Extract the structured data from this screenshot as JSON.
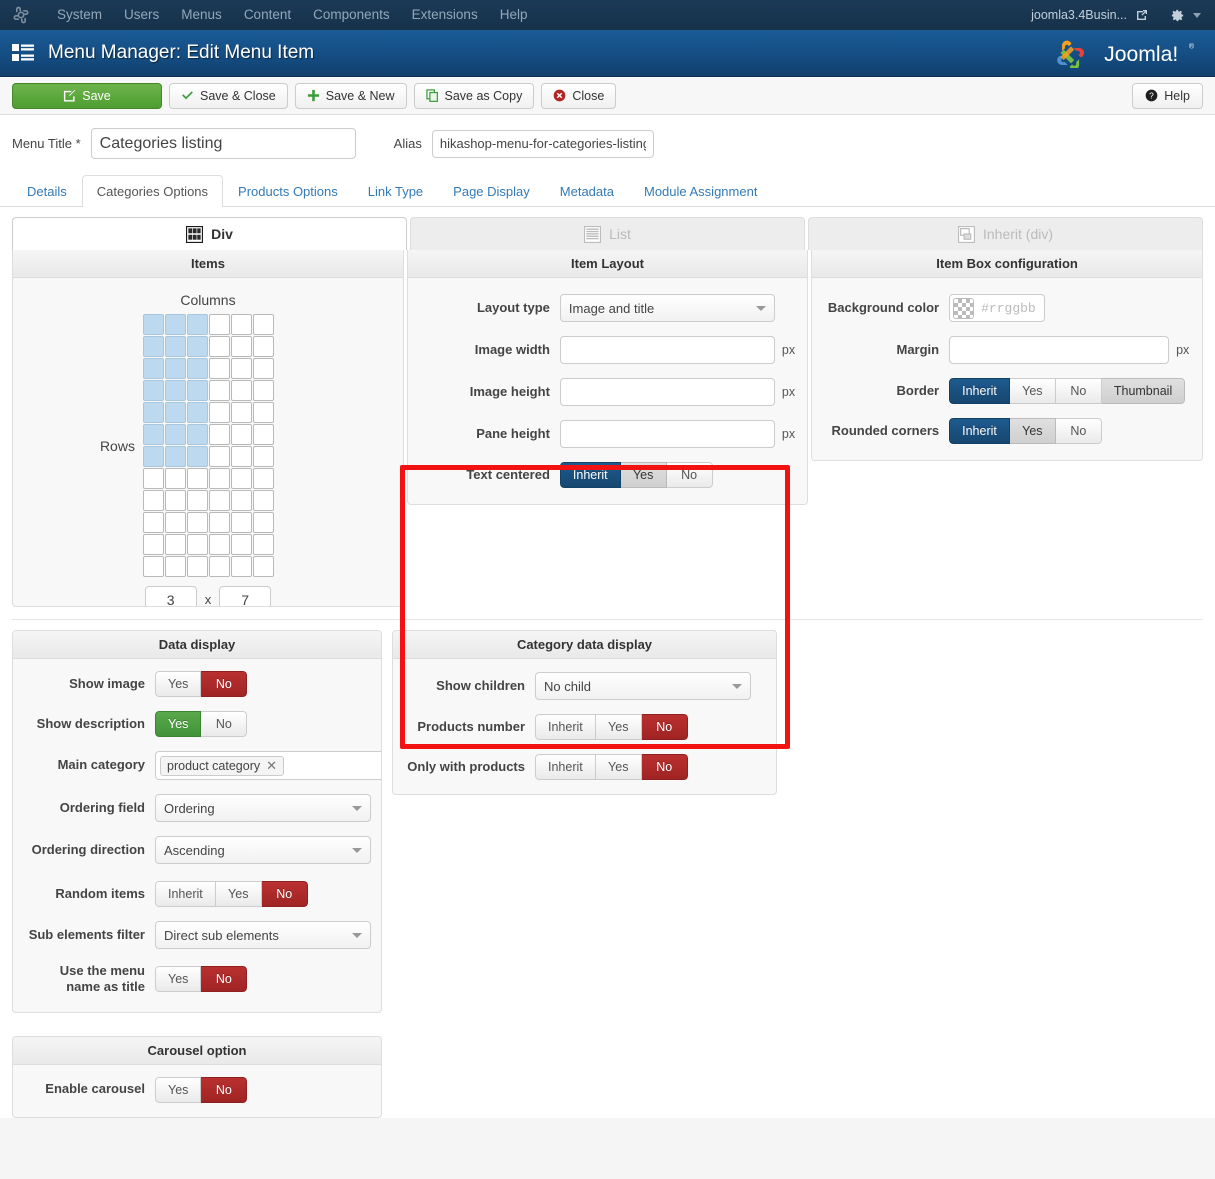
{
  "adminbar": {
    "logo_icon": "joomla-brand-icon",
    "items": [
      {
        "label": "System",
        "name": "adminbar-item-system"
      },
      {
        "label": "Users",
        "name": "adminbar-item-users"
      },
      {
        "label": "Menus",
        "name": "adminbar-item-menus"
      },
      {
        "label": "Content",
        "name": "adminbar-item-content"
      },
      {
        "label": "Components",
        "name": "adminbar-item-components"
      },
      {
        "label": "Extensions",
        "name": "adminbar-item-extensions"
      },
      {
        "label": "Help",
        "name": "adminbar-item-help"
      }
    ],
    "site_name": "joomla3.4Busin...",
    "external_link_icon": "external-link-icon",
    "gear_icon": "gear-icon",
    "caret_icon": "chevron-down-icon"
  },
  "header": {
    "menu_icon": "menu-list-icon",
    "title": "Menu Manager: Edit Menu Item",
    "brand": "Joomla!"
  },
  "toolbar": {
    "save_label": "Save",
    "save_close_label": "Save & Close",
    "save_new_label": "Save & New",
    "save_copy_label": "Save as Copy",
    "close_label": "Close",
    "help_label": "Help"
  },
  "titlerow": {
    "menu_title_label": "Menu Title *",
    "menu_title_value": "Categories listing",
    "alias_label": "Alias",
    "alias_value": "hikashop-menu-for-categories-listing"
  },
  "tabs": [
    {
      "label": "Details",
      "active": false
    },
    {
      "label": "Categories Options",
      "active": true
    },
    {
      "label": "Products Options",
      "active": false
    },
    {
      "label": "Link Type",
      "active": false
    },
    {
      "label": "Page Display",
      "active": false
    },
    {
      "label": "Metadata",
      "active": false
    },
    {
      "label": "Module Assignment",
      "active": false
    }
  ],
  "layout_tabs": [
    {
      "label": "Div",
      "icon": "grid-blocks-icon",
      "active": true
    },
    {
      "label": "List",
      "icon": "list-lines-icon",
      "active": false
    },
    {
      "label": "Inherit (div)",
      "icon": "inherit-boxes-icon",
      "active": false
    }
  ],
  "items_panel": {
    "title": "Items",
    "columns_label": "Columns",
    "rows_label": "Rows",
    "grid_cols": 6,
    "grid_rows": 12,
    "selected_cols": 3,
    "selected_rows": 7,
    "cols_value": "3",
    "rows_value": "7",
    "x_label": "x"
  },
  "item_layout": {
    "title": "Item Layout",
    "highlighted": true,
    "highlight_color": "#f21212",
    "layout_type": {
      "label": "Layout type",
      "value": "Image and title"
    },
    "image_width": {
      "label": "Image width",
      "value": "",
      "unit": "px"
    },
    "image_height": {
      "label": "Image height",
      "value": "",
      "unit": "px"
    },
    "pane_height": {
      "label": "Pane height",
      "value": "",
      "unit": "px"
    },
    "text_centered": {
      "label": "Text centered",
      "options": [
        "Inherit",
        "Yes",
        "No"
      ],
      "selected": "Inherit",
      "selected_style": "blue"
    }
  },
  "item_box": {
    "title": "Item Box configuration",
    "background_color": {
      "label": "Background color",
      "value": "",
      "placeholder": "#rrggbb",
      "swatch": "transparent-checker"
    },
    "margin": {
      "label": "Margin",
      "value": "",
      "unit": "px"
    },
    "border": {
      "label": "Border",
      "options": [
        "Inherit",
        "Yes",
        "No",
        "Thumbnail"
      ],
      "selected": "Inherit",
      "selected_style": "blue",
      "hover": "Thumbnail"
    },
    "rounded_corners": {
      "label": "Rounded corners",
      "options": [
        "Inherit",
        "Yes",
        "No"
      ],
      "selected": "Inherit",
      "selected_style": "blue",
      "hover": "Yes"
    }
  },
  "data_display": {
    "title": "Data display",
    "show_image": {
      "label": "Show image",
      "options": [
        "Yes",
        "No"
      ],
      "selected": "No",
      "selected_style": "red"
    },
    "show_description": {
      "label": "Show description",
      "options": [
        "Yes",
        "No"
      ],
      "selected": "Yes",
      "selected_style": "green"
    },
    "main_category": {
      "label": "Main category",
      "tag": "product category",
      "remove_icon": "close-icon"
    },
    "ordering_field": {
      "label": "Ordering field",
      "value": "Ordering"
    },
    "ordering_direction": {
      "label": "Ordering direction",
      "value": "Ascending"
    },
    "random_items": {
      "label": "Random items",
      "options": [
        "Inherit",
        "Yes",
        "No"
      ],
      "selected": "No",
      "selected_style": "red"
    },
    "sub_elements_filter": {
      "label": "Sub elements filter",
      "value": "Direct sub elements"
    },
    "use_menu_name": {
      "label": "Use the menu name as title",
      "options": [
        "Yes",
        "No"
      ],
      "selected": "No",
      "selected_style": "red"
    }
  },
  "category_data_display": {
    "title": "Category data display",
    "show_children": {
      "label": "Show children",
      "value": "No child"
    },
    "products_number": {
      "label": "Products number",
      "options": [
        "Inherit",
        "Yes",
        "No"
      ],
      "selected": "No",
      "selected_style": "red"
    },
    "only_with_products": {
      "label": "Only with products",
      "options": [
        "Inherit",
        "Yes",
        "No"
      ],
      "selected": "No",
      "selected_style": "red"
    }
  },
  "carousel": {
    "title": "Carousel option",
    "enable_carousel": {
      "label": "Enable carousel",
      "options": [
        "Yes",
        "No"
      ],
      "selected": "No",
      "selected_style": "red"
    }
  }
}
